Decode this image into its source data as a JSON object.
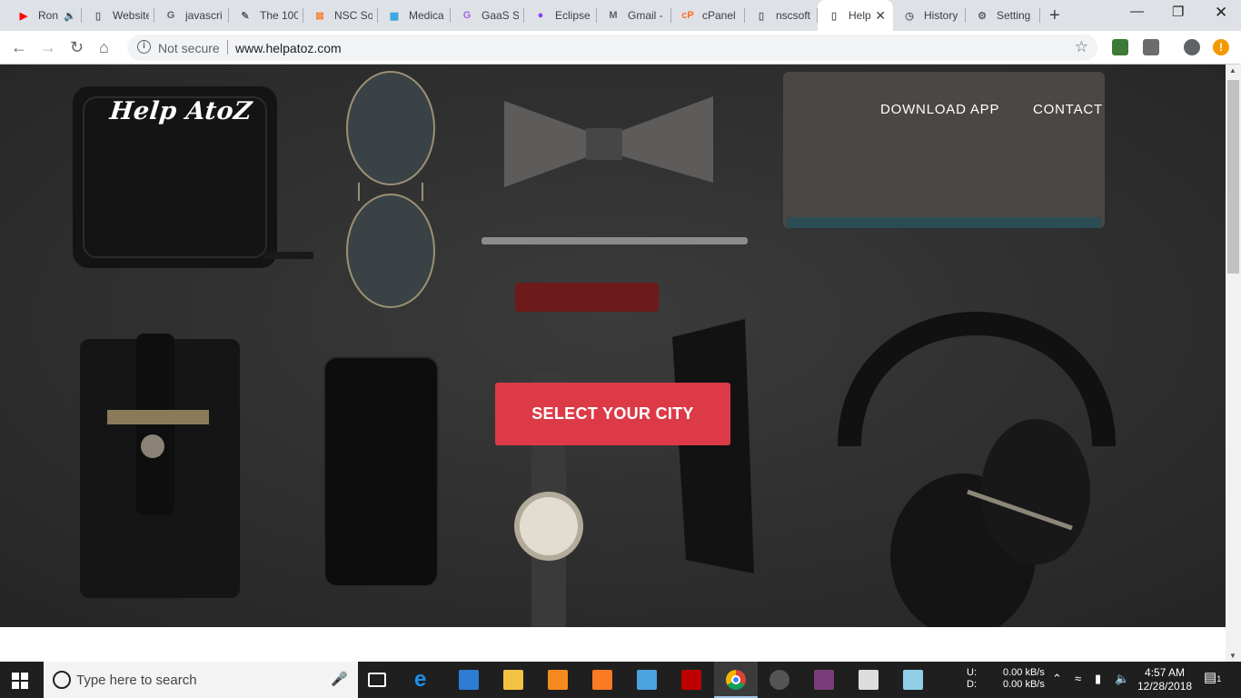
{
  "browser": {
    "tabs": [
      {
        "title": "Ron",
        "favicon": "youtube-icon",
        "color": "#ff0000",
        "glyph": "▶"
      },
      {
        "title": "Website",
        "favicon": "page-icon",
        "color": "#ffffff",
        "glyph": "▯"
      },
      {
        "title": "javascri",
        "favicon": "google-icon",
        "color": "#ffffff",
        "glyph": "G"
      },
      {
        "title": "The 100",
        "favicon": "leaf-icon",
        "color": "#ffffff",
        "glyph": "✎"
      },
      {
        "title": "NSC So",
        "favicon": "xampp-icon",
        "color": "#fb7a24",
        "glyph": "⊠"
      },
      {
        "title": "Medica",
        "favicon": "grid-icon",
        "color": "#2aa1e0",
        "glyph": "▦"
      },
      {
        "title": "GaaS Sc",
        "favicon": "gaas-icon",
        "color": "#9b6ae0",
        "glyph": "G"
      },
      {
        "title": "Eclipse",
        "favicon": "eclipse-icon",
        "color": "#8a3ffc",
        "glyph": "●"
      },
      {
        "title": "Gmail -",
        "favicon": "gmail-icon",
        "color": "#ffffff",
        "glyph": "M"
      },
      {
        "title": "cPanel",
        "favicon": "cpanel-icon",
        "color": "#ff6c2c",
        "glyph": "cP"
      },
      {
        "title": "nscsoft",
        "favicon": "page-icon",
        "color": "#ffffff",
        "glyph": "▯"
      },
      {
        "title": "Help",
        "favicon": "page-icon",
        "color": "#ffffff",
        "glyph": "▯"
      },
      {
        "title": "History",
        "favicon": "history-icon",
        "color": "#ffffff",
        "glyph": "◷"
      },
      {
        "title": "Setting",
        "favicon": "settings-icon",
        "color": "#ffffff",
        "glyph": "⚙"
      }
    ],
    "address": {
      "security_label": "Not secure",
      "url": "www.helpatoz.com"
    }
  },
  "site": {
    "logo_text": "Help AtoZ",
    "nav": [
      "DOWNLOAD APP",
      "CONTACT"
    ],
    "cta_label": "SELECT YOUR CITY",
    "cta_color": "#dd3a48"
  },
  "taskbar": {
    "search_placeholder": "Type here to search",
    "net_labels": [
      "U:",
      "D:"
    ],
    "net_speeds": [
      "0.00 kB/s",
      "0.00 kB/s"
    ],
    "time": "4:57 AM",
    "date": "12/28/2018",
    "notification_count": "1"
  }
}
